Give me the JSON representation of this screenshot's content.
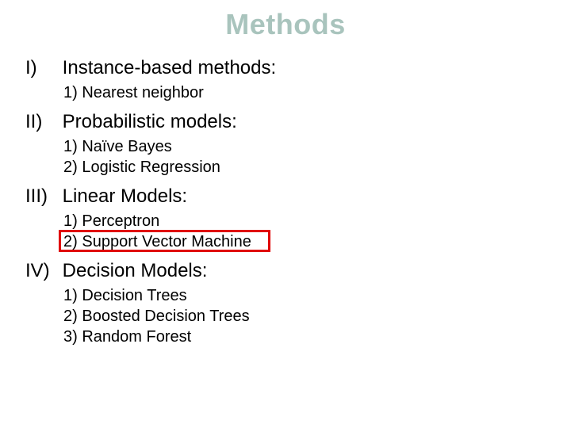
{
  "title": "Methods",
  "sections": [
    {
      "num": "I)",
      "label": "Instance-based methods:",
      "items": [
        {
          "num": "1)",
          "label": "Nearest neighbor"
        }
      ]
    },
    {
      "num": "II)",
      "label": "Probabilistic models:",
      "items": [
        {
          "num": "1)",
          "label": "Naïve Bayes"
        },
        {
          "num": "2)",
          "label": "Logistic Regression"
        }
      ]
    },
    {
      "num": "III)",
      "label": "Linear Models:",
      "items": [
        {
          "num": "1)",
          "label": "Perceptron"
        },
        {
          "num": "2)",
          "label": "Support Vector Machine"
        }
      ]
    },
    {
      "num": "IV)",
      "label": "Decision Models:",
      "items": [
        {
          "num": "1)",
          "label": "Decision Trees"
        },
        {
          "num": "2)",
          "label": "Boosted Decision Trees"
        },
        {
          "num": "3)",
          "label": "Random Forest"
        }
      ]
    }
  ],
  "highlight_box_color": "#e00000"
}
